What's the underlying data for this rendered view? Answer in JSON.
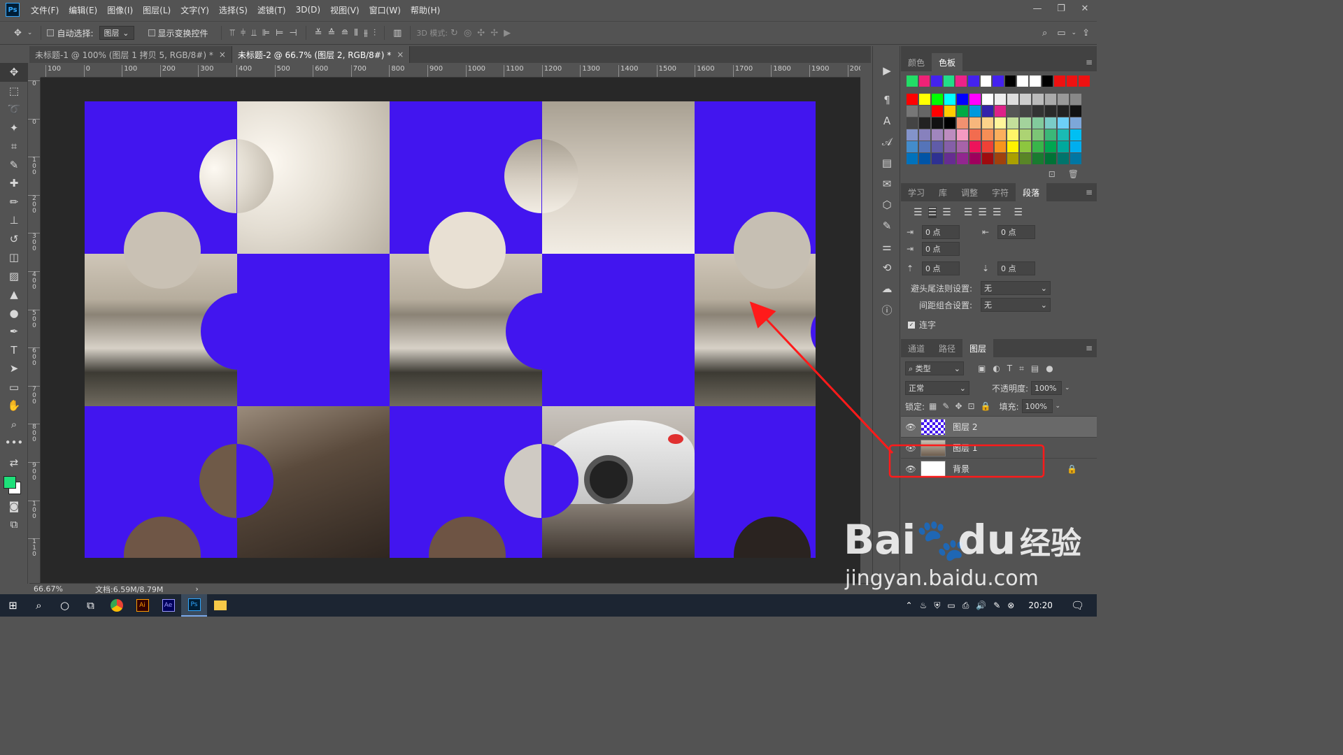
{
  "app": {
    "logo": "Ps"
  },
  "menu": [
    "文件(F)",
    "编辑(E)",
    "图像(I)",
    "图层(L)",
    "文字(Y)",
    "选择(S)",
    "滤镜(T)",
    "3D(D)",
    "视图(V)",
    "窗口(W)",
    "帮助(H)"
  ],
  "options": {
    "auto_select": "自动选择:",
    "auto_select_value": "图层",
    "show_transform": "显示变换控件",
    "mode3d": "3D 模式:"
  },
  "tabs": [
    {
      "label": "未标题-1 @ 100% (图层 1 拷贝 5, RGB/8#) *",
      "close": "×"
    },
    {
      "label": "未标题-2 @ 66.7% (图层 2, RGB/8#) *",
      "close": "×"
    }
  ],
  "ruler_h": [
    "100",
    "0",
    "100",
    "200",
    "300",
    "400",
    "500",
    "600",
    "700",
    "800",
    "900",
    "1000",
    "1100",
    "1200",
    "1300",
    "1400",
    "1500",
    "1600",
    "1700",
    "1800",
    "1900",
    "200"
  ],
  "ruler_v": [
    "0",
    "0",
    "100",
    "200",
    "300",
    "400",
    "500",
    "600",
    "700",
    "800",
    "900",
    "100",
    "110"
  ],
  "swatch_tabs": [
    "颜色",
    "色板"
  ],
  "para_tabs": [
    "学习",
    "库",
    "调整",
    "字符",
    "段落"
  ],
  "paragraph": {
    "indent_left": "0 点",
    "indent_right": "0 点",
    "indent_first": "0 点",
    "space_before": "0 点",
    "space_after": "0 点",
    "kinsoku_label": "避头尾法则设置:",
    "kinsoku_value": "无",
    "mojikumi_label": "间距组合设置:",
    "mojikumi_value": "无",
    "hyphenate": "连字"
  },
  "layer_tabs": [
    "通道",
    "路径",
    "图层"
  ],
  "layers_panel": {
    "filter": "类型",
    "blend": "正常",
    "opacity_label": "不透明度:",
    "opacity": "100%",
    "lock_label": "锁定:",
    "fill_label": "填充:",
    "fill": "100%"
  },
  "layers": [
    {
      "name": "图层 2",
      "selected": true
    },
    {
      "name": "图层 1",
      "selected": false
    },
    {
      "name": "背景",
      "selected": false,
      "locked": true
    }
  ],
  "status": {
    "zoom": "66.67%",
    "doc": "文档:6.59M/8.79M",
    "arrow": "›"
  },
  "taskbar": {
    "time": "20:20"
  },
  "colors": {
    "fg": "#1ee07a",
    "bg": "#ffffff",
    "annotation": "#ff1a1a",
    "fill_blue": "#4215ef"
  },
  "watermark": {
    "brand": "Bai",
    "brand2": "du",
    "brand_cn": "经验",
    "url": "jingyan.baidu.com"
  }
}
